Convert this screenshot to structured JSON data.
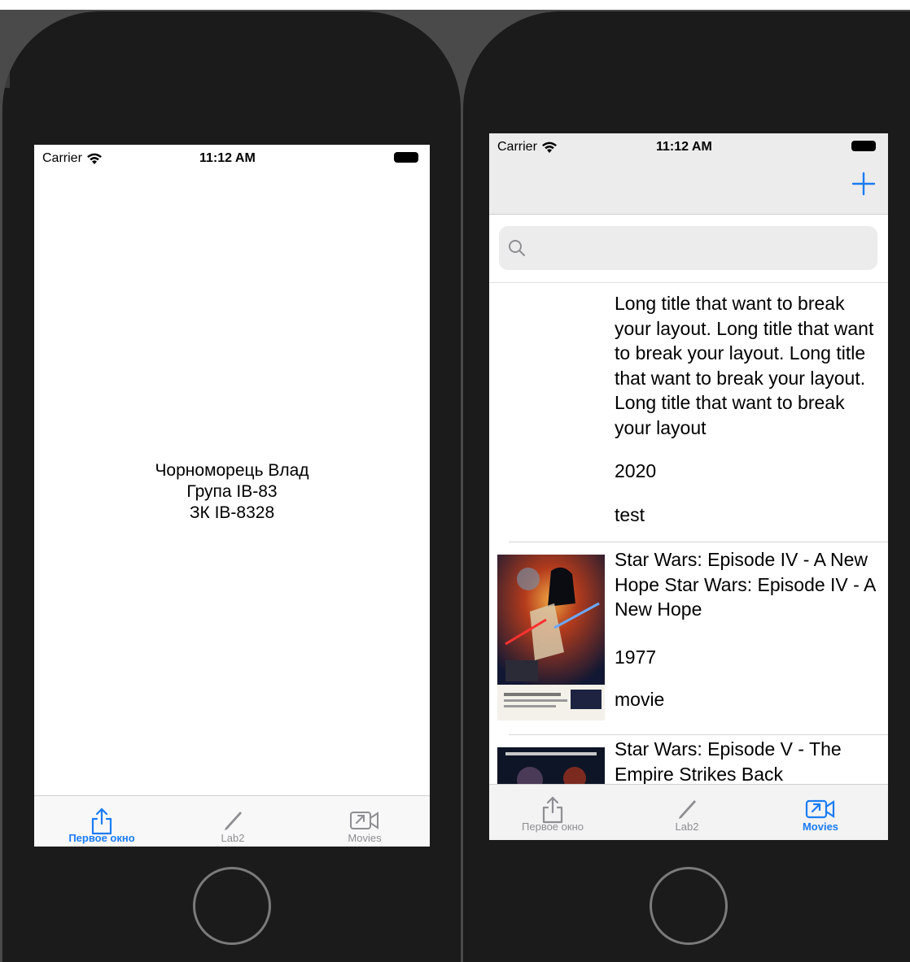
{
  "colors": {
    "accent": "#1a7cf5",
    "inactive": "#8e8e93",
    "bezel": "#1b1b1b"
  },
  "status_bar": {
    "carrier": "Carrier",
    "time": "11:12 AM"
  },
  "about_screen": {
    "name": "Чорноморець Влад",
    "group": "Група ІВ-83",
    "record_book": "ЗК ІВ-8328"
  },
  "tabbar": {
    "tabs": [
      {
        "label": "Первое окно",
        "icon": "share-icon"
      },
      {
        "label": "Lab2",
        "icon": "pencil-icon"
      },
      {
        "label": "Movies",
        "icon": "video-icon"
      }
    ]
  },
  "movies_screen": {
    "add_icon": "plus-icon",
    "search": {
      "placeholder": "",
      "icon": "search-icon"
    },
    "movies": [
      {
        "title": "Long title that want to break your layout. Long title that want to break your layout. Long title that want to break your layout. Long title that want to break your layout",
        "year": "2020",
        "type": "test",
        "poster": "none"
      },
      {
        "title": "Star Wars: Episode IV - A New Hope Star Wars: Episode IV - A New Hope",
        "year": "1977",
        "type": "movie",
        "poster": "star-wars-iv-poster"
      },
      {
        "title": "Star Wars: Episode V - The Empire Strikes Back",
        "year": "",
        "type": "",
        "poster": "star-wars-v-poster"
      }
    ]
  }
}
